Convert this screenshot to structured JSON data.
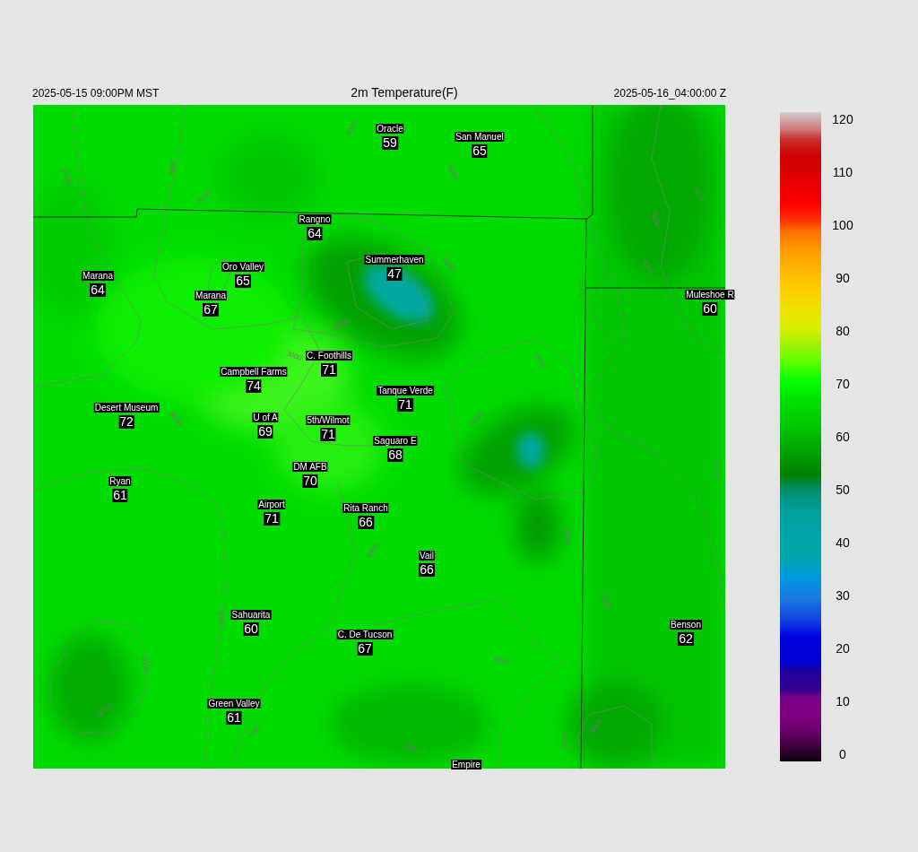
{
  "header": {
    "valid_local": "2025-05-15 09:00PM MST",
    "title": "2m Temperature(F)",
    "valid_utc": "2025-05-16_04:00:00 Z"
  },
  "stations": [
    {
      "name": "Oracle",
      "value": "59"
    },
    {
      "name": "San Manuel",
      "value": "65"
    },
    {
      "name": "Rangno",
      "value": "64"
    },
    {
      "name": "Summerhaven",
      "value": "47"
    },
    {
      "name": "Marana",
      "value": "64"
    },
    {
      "name": "Oro Valley",
      "value": "65"
    },
    {
      "name": "Marana",
      "value": "67"
    },
    {
      "name": "Muleshoe R",
      "value": "60"
    },
    {
      "name": "C. Foothills",
      "value": "71"
    },
    {
      "name": "Campbell Farms",
      "value": "74"
    },
    {
      "name": "Tanque Verde",
      "value": "71"
    },
    {
      "name": "Desert Museum",
      "value": "72"
    },
    {
      "name": "U of A",
      "value": "69"
    },
    {
      "name": "5th/Wilmot",
      "value": "71"
    },
    {
      "name": "Saguaro E",
      "value": "68"
    },
    {
      "name": "DM AFB",
      "value": "70"
    },
    {
      "name": "Ryan",
      "value": "61"
    },
    {
      "name": "Airport",
      "value": "71"
    },
    {
      "name": "Rita Ranch",
      "value": "66"
    },
    {
      "name": "Vail",
      "value": "66"
    },
    {
      "name": "Sahuarita",
      "value": "60"
    },
    {
      "name": "C. De Tucson",
      "value": "67"
    },
    {
      "name": "Benson",
      "value": "62"
    },
    {
      "name": "Green Valley",
      "value": "61"
    },
    {
      "name": "Empire"
    }
  ],
  "contour_labels": [
    "4000",
    "2000",
    "3000",
    "4000",
    "6000",
    "3000",
    "3000",
    "4000",
    "5000",
    "3000",
    "6000",
    "5000",
    "4000",
    "4000",
    "4000",
    "3000",
    "3000",
    "4000",
    "5000",
    "3000",
    "4000",
    "5000",
    "4000",
    "4000",
    "5000",
    "5000",
    "6000"
  ],
  "colorbar": {
    "ticks": [
      "120",
      "110",
      "100",
      "90",
      "80",
      "70",
      "60",
      "50",
      "40",
      "30",
      "20",
      "10",
      "0"
    ]
  }
}
